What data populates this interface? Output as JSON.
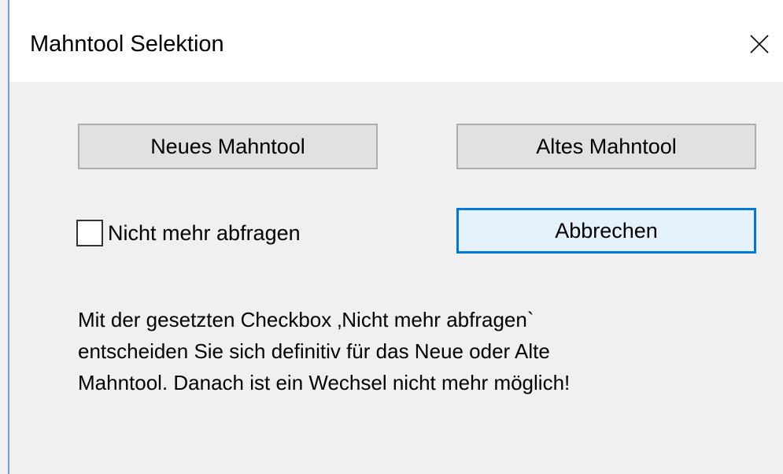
{
  "window": {
    "title": "Mahntool Selektion",
    "close_icon": "close-x-icon"
  },
  "buttons": {
    "neues_mahntool": "Neues Mahntool",
    "altes_mahntool": "Altes Mahntool",
    "abbrechen": "Abbrechen"
  },
  "checkbox": {
    "label": "Nicht mehr abfragen",
    "checked": false
  },
  "info": {
    "lines": [
      "Mit der gesetzten Checkbox ‚Nicht mehr abfragen`",
      "entscheiden Sie sich definitiv für das Neue oder Alte",
      "Mahntool. Danach ist ein Wechsel nicht mehr möglich!"
    ]
  },
  "colors": {
    "accent_focus": "#0078d7",
    "dialog_bg": "#f0f0f0",
    "button_bg": "#e1e1e1",
    "window_border": "#6f9fd8"
  }
}
